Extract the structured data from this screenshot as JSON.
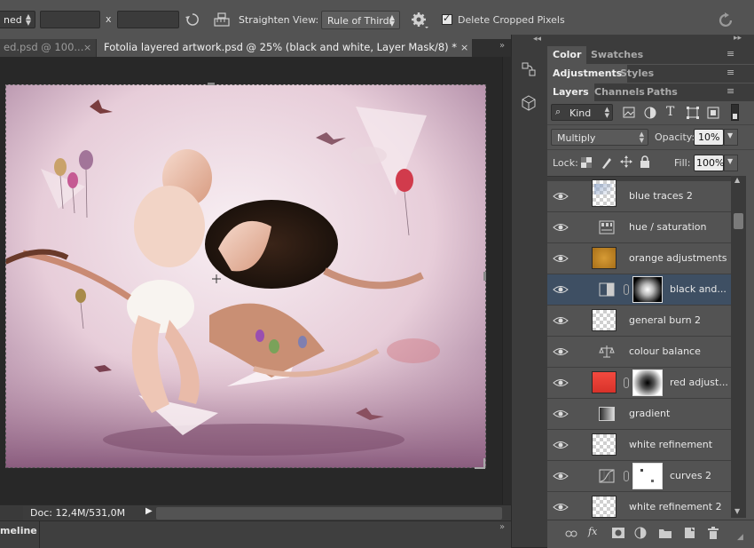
{
  "options_bar": {
    "mode_partial": "ned",
    "ratio_separator": "x",
    "straighten_label": "Straighten",
    "view_label": "View:",
    "view_value": "Rule of Thirds",
    "delete_cropped_label": "Delete Cropped Pixels",
    "delete_cropped_checked": true
  },
  "tabs": [
    {
      "label": "ed.psd @ 100...",
      "active": false
    },
    {
      "label": "Fotolia layered artwork.psd @ 25% (black and white, Layer Mask/8) *",
      "active": true
    }
  ],
  "status": {
    "doc_info": "Doc: 12,4M/531,0M",
    "timeline_label": "meline"
  },
  "panels": {
    "group1": [
      {
        "label": "Color",
        "active": true
      },
      {
        "label": "Swatches",
        "active": false
      }
    ],
    "group2": [
      {
        "label": "Adjustments",
        "active": true
      },
      {
        "label": "Styles",
        "active": false
      }
    ],
    "group3": [
      {
        "label": "Layers",
        "active": true
      },
      {
        "label": "Channels",
        "active": false
      },
      {
        "label": "Paths",
        "active": false
      }
    ]
  },
  "layers_panel": {
    "filter_kind": "Kind",
    "blend_mode": "Multiply",
    "opacity_label": "Opacity:",
    "opacity_value": "10%",
    "lock_label": "Lock:",
    "fill_label": "Fill:",
    "fill_value": "100%",
    "layers": [
      {
        "name": "blue traces 2",
        "thumb": "checker-blue",
        "selected": false
      },
      {
        "name": "hue / saturation",
        "thumb": "hue-sat-icon",
        "selected": false
      },
      {
        "name": "orange adjustments",
        "thumb": "orange-fill",
        "selected": false
      },
      {
        "name": "black and...",
        "thumb": "bw-adjustment",
        "selected": true
      },
      {
        "name": "general burn 2",
        "thumb": "checker",
        "selected": false
      },
      {
        "name": "colour balance",
        "thumb": "balance-icon",
        "selected": false
      },
      {
        "name": "red adjust...",
        "thumb": "red-fill",
        "selected": false
      },
      {
        "name": "gradient",
        "thumb": "gradient-icon",
        "selected": false
      },
      {
        "name": "white refinement",
        "thumb": "checker",
        "selected": false
      },
      {
        "name": "curves 2",
        "thumb": "curves-icon",
        "selected": false
      },
      {
        "name": "white refinement 2",
        "thumb": "checker",
        "selected": false
      }
    ]
  },
  "footer_icons": [
    "link-icon",
    "fx-icon",
    "mask-icon",
    "adjustment-icon",
    "folder-icon",
    "new-layer-icon",
    "trash-icon"
  ],
  "colors": {
    "panel_bg": "#535353",
    "selected_layer": "#3e4f63",
    "canvas_bg": "#282828"
  }
}
